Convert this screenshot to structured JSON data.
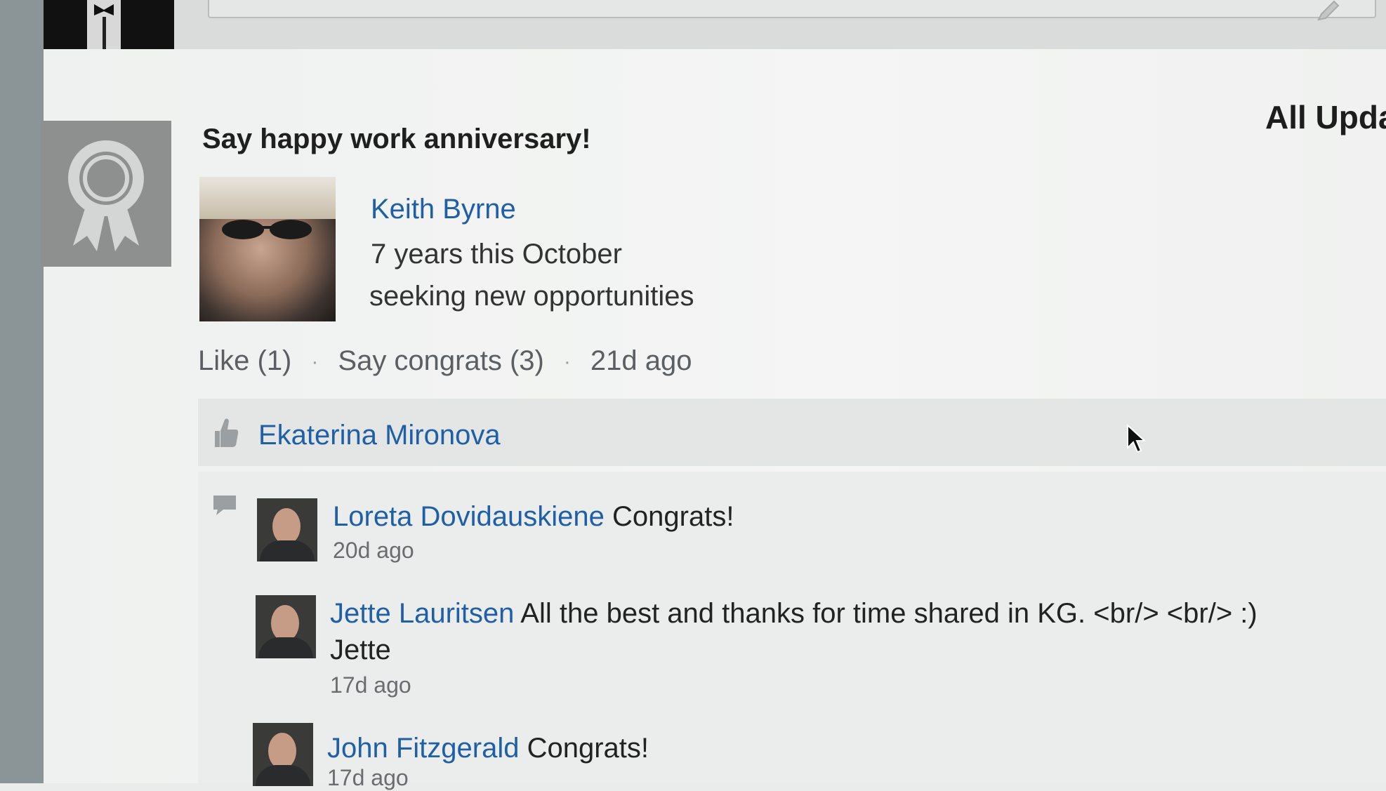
{
  "header": {
    "heading_partial": "All Upda"
  },
  "card": {
    "title": "Say happy work anniversary!",
    "person": {
      "name": "Keith Byrne",
      "years": "7 years this October",
      "status": "seeking new opportunities"
    },
    "actions": {
      "like": "Like (1)",
      "congrats": "Say congrats (3)",
      "time": "21d ago",
      "separator": "·"
    },
    "liker": "Ekaterina Mironova",
    "comments": [
      {
        "name": "Loreta Dovidauskiene",
        "text": "Congrats!",
        "time": "20d ago"
      },
      {
        "name": "Jette Lauritsen",
        "text": "All the best and thanks for time shared in KG. <br/> <br/> :)",
        "line2": "Jette",
        "time": "17d ago"
      },
      {
        "name": "John Fitzgerald",
        "text": "Congrats!",
        "time": "17d ago"
      }
    ]
  },
  "icons": {
    "badge": "award-ribbon-icon",
    "thumb": "thumbs-up-icon",
    "comment": "comment-bubble-icon",
    "pencil": "pencil-icon",
    "cursor": "mouse-cursor-icon"
  },
  "colors": {
    "link": "#1f5fa8",
    "text": "#222222",
    "muted": "#5b5f63"
  }
}
